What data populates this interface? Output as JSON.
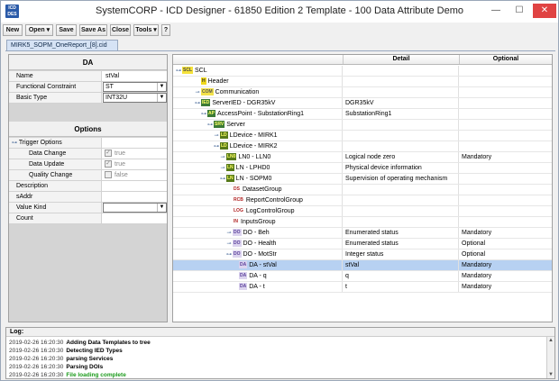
{
  "window": {
    "app_icon": "ICD\nDES",
    "title": "SystemCORP - ICD Designer - 61850 Edition 2 Template - 100 Data Attribute Demo",
    "minimize": "—",
    "maximize": "☐",
    "close": "✕"
  },
  "toolbar": {
    "new": "New",
    "open": "Open ▾",
    "save": "Save",
    "save_as": "Save As",
    "close": "Close",
    "tools": "Tools ▾",
    "help": "?"
  },
  "doc_tab": "MIRK5_SOPM_OneReport_[8].cid",
  "da_panel": {
    "header": "DA",
    "name_label": "Name",
    "name_value": "stVal",
    "fc_label": "Functional Constraint",
    "fc_value": "ST",
    "bt_label": "Basic Type",
    "bt_value": "INT32U"
  },
  "options_panel": {
    "header": "Options",
    "trigger_options": "Trigger Options",
    "data_change": "Data Change",
    "data_change_val": "true",
    "data_update": "Data Update",
    "data_update_val": "true",
    "quality_change": "Quality Change",
    "quality_change_val": "false",
    "description": "Description",
    "saddr": "sAddr",
    "value_kind": "Value Kind",
    "count": "Count"
  },
  "tree": {
    "col_name": "",
    "col_detail": "Detail",
    "col_optional": "Optional",
    "rows": [
      {
        "label": "SCL",
        "badge": "SCL",
        "detail": "",
        "optional": ""
      },
      {
        "label": "Header",
        "badge": "H",
        "detail": "",
        "optional": ""
      },
      {
        "label": "Communication",
        "badge": "COM",
        "detail": "",
        "optional": ""
      },
      {
        "label": "ServerIED - DGR35kV",
        "badge": "IED",
        "detail": "DGR35kV",
        "optional": ""
      },
      {
        "label": "AccessPoint - SubstationRing1",
        "badge": "AP",
        "detail": "SubstationRing1",
        "optional": ""
      },
      {
        "label": "Server",
        "badge": "SRV",
        "detail": "",
        "optional": ""
      },
      {
        "label": "LDevice - MIRK1",
        "badge": "LD",
        "detail": "",
        "optional": ""
      },
      {
        "label": "LDevice - MIRK2",
        "badge": "LD",
        "detail": "",
        "optional": ""
      },
      {
        "label": "LN0 - LLN0",
        "badge": "LN0",
        "detail": "Logical node zero",
        "optional": "Mandatory"
      },
      {
        "label": "LN - LPHD0",
        "badge": "LN",
        "detail": "Physical device information",
        "optional": ""
      },
      {
        "label": "LN - SOPM0",
        "badge": "LN",
        "detail": "Supervision of operating mechanism",
        "optional": ""
      },
      {
        "label": "DatasetGroup",
        "badge": "DS",
        "detail": "",
        "optional": ""
      },
      {
        "label": "ReportControlGroup",
        "badge": "RCB",
        "detail": "",
        "optional": ""
      },
      {
        "label": "LogControlGroup",
        "badge": "LOG",
        "detail": "",
        "optional": ""
      },
      {
        "label": "InputsGroup",
        "badge": "IN",
        "detail": "",
        "optional": ""
      },
      {
        "label": "DO - Beh",
        "badge": "DO",
        "detail": "Enumerated status",
        "optional": "Mandatory"
      },
      {
        "label": "DO - Health",
        "badge": "DO",
        "detail": "Enumerated status",
        "optional": "Optional"
      },
      {
        "label": "DO - MotStr",
        "badge": "DO",
        "detail": "Integer status",
        "optional": "Optional"
      },
      {
        "label": "DA - stVal",
        "badge": "DA",
        "detail": "stVal",
        "optional": "Mandatory"
      },
      {
        "label": "DA - q",
        "badge": "DA",
        "detail": "q",
        "optional": "Mandatory"
      },
      {
        "label": "DA - t",
        "badge": "DA",
        "detail": "t",
        "optional": "Mandatory"
      }
    ]
  },
  "log": {
    "title": "Log:",
    "lines": [
      {
        "ts": "2019-02-26 16:20:30",
        "msg": "Adding Data Templates to tree",
        "color": "#000000"
      },
      {
        "ts": "2019-02-26 16:20:30",
        "msg": "Detecting IED Types",
        "color": "#000000"
      },
      {
        "ts": "2019-02-26 16:20:30",
        "msg": "parsing Services",
        "color": "#000000"
      },
      {
        "ts": "2019-02-26 16:20:30",
        "msg": "Parsing DOIs",
        "color": "#000000"
      },
      {
        "ts": "2019-02-26 16:20:30",
        "msg": "File loading complete",
        "color": "#1a9a1a"
      }
    ]
  }
}
